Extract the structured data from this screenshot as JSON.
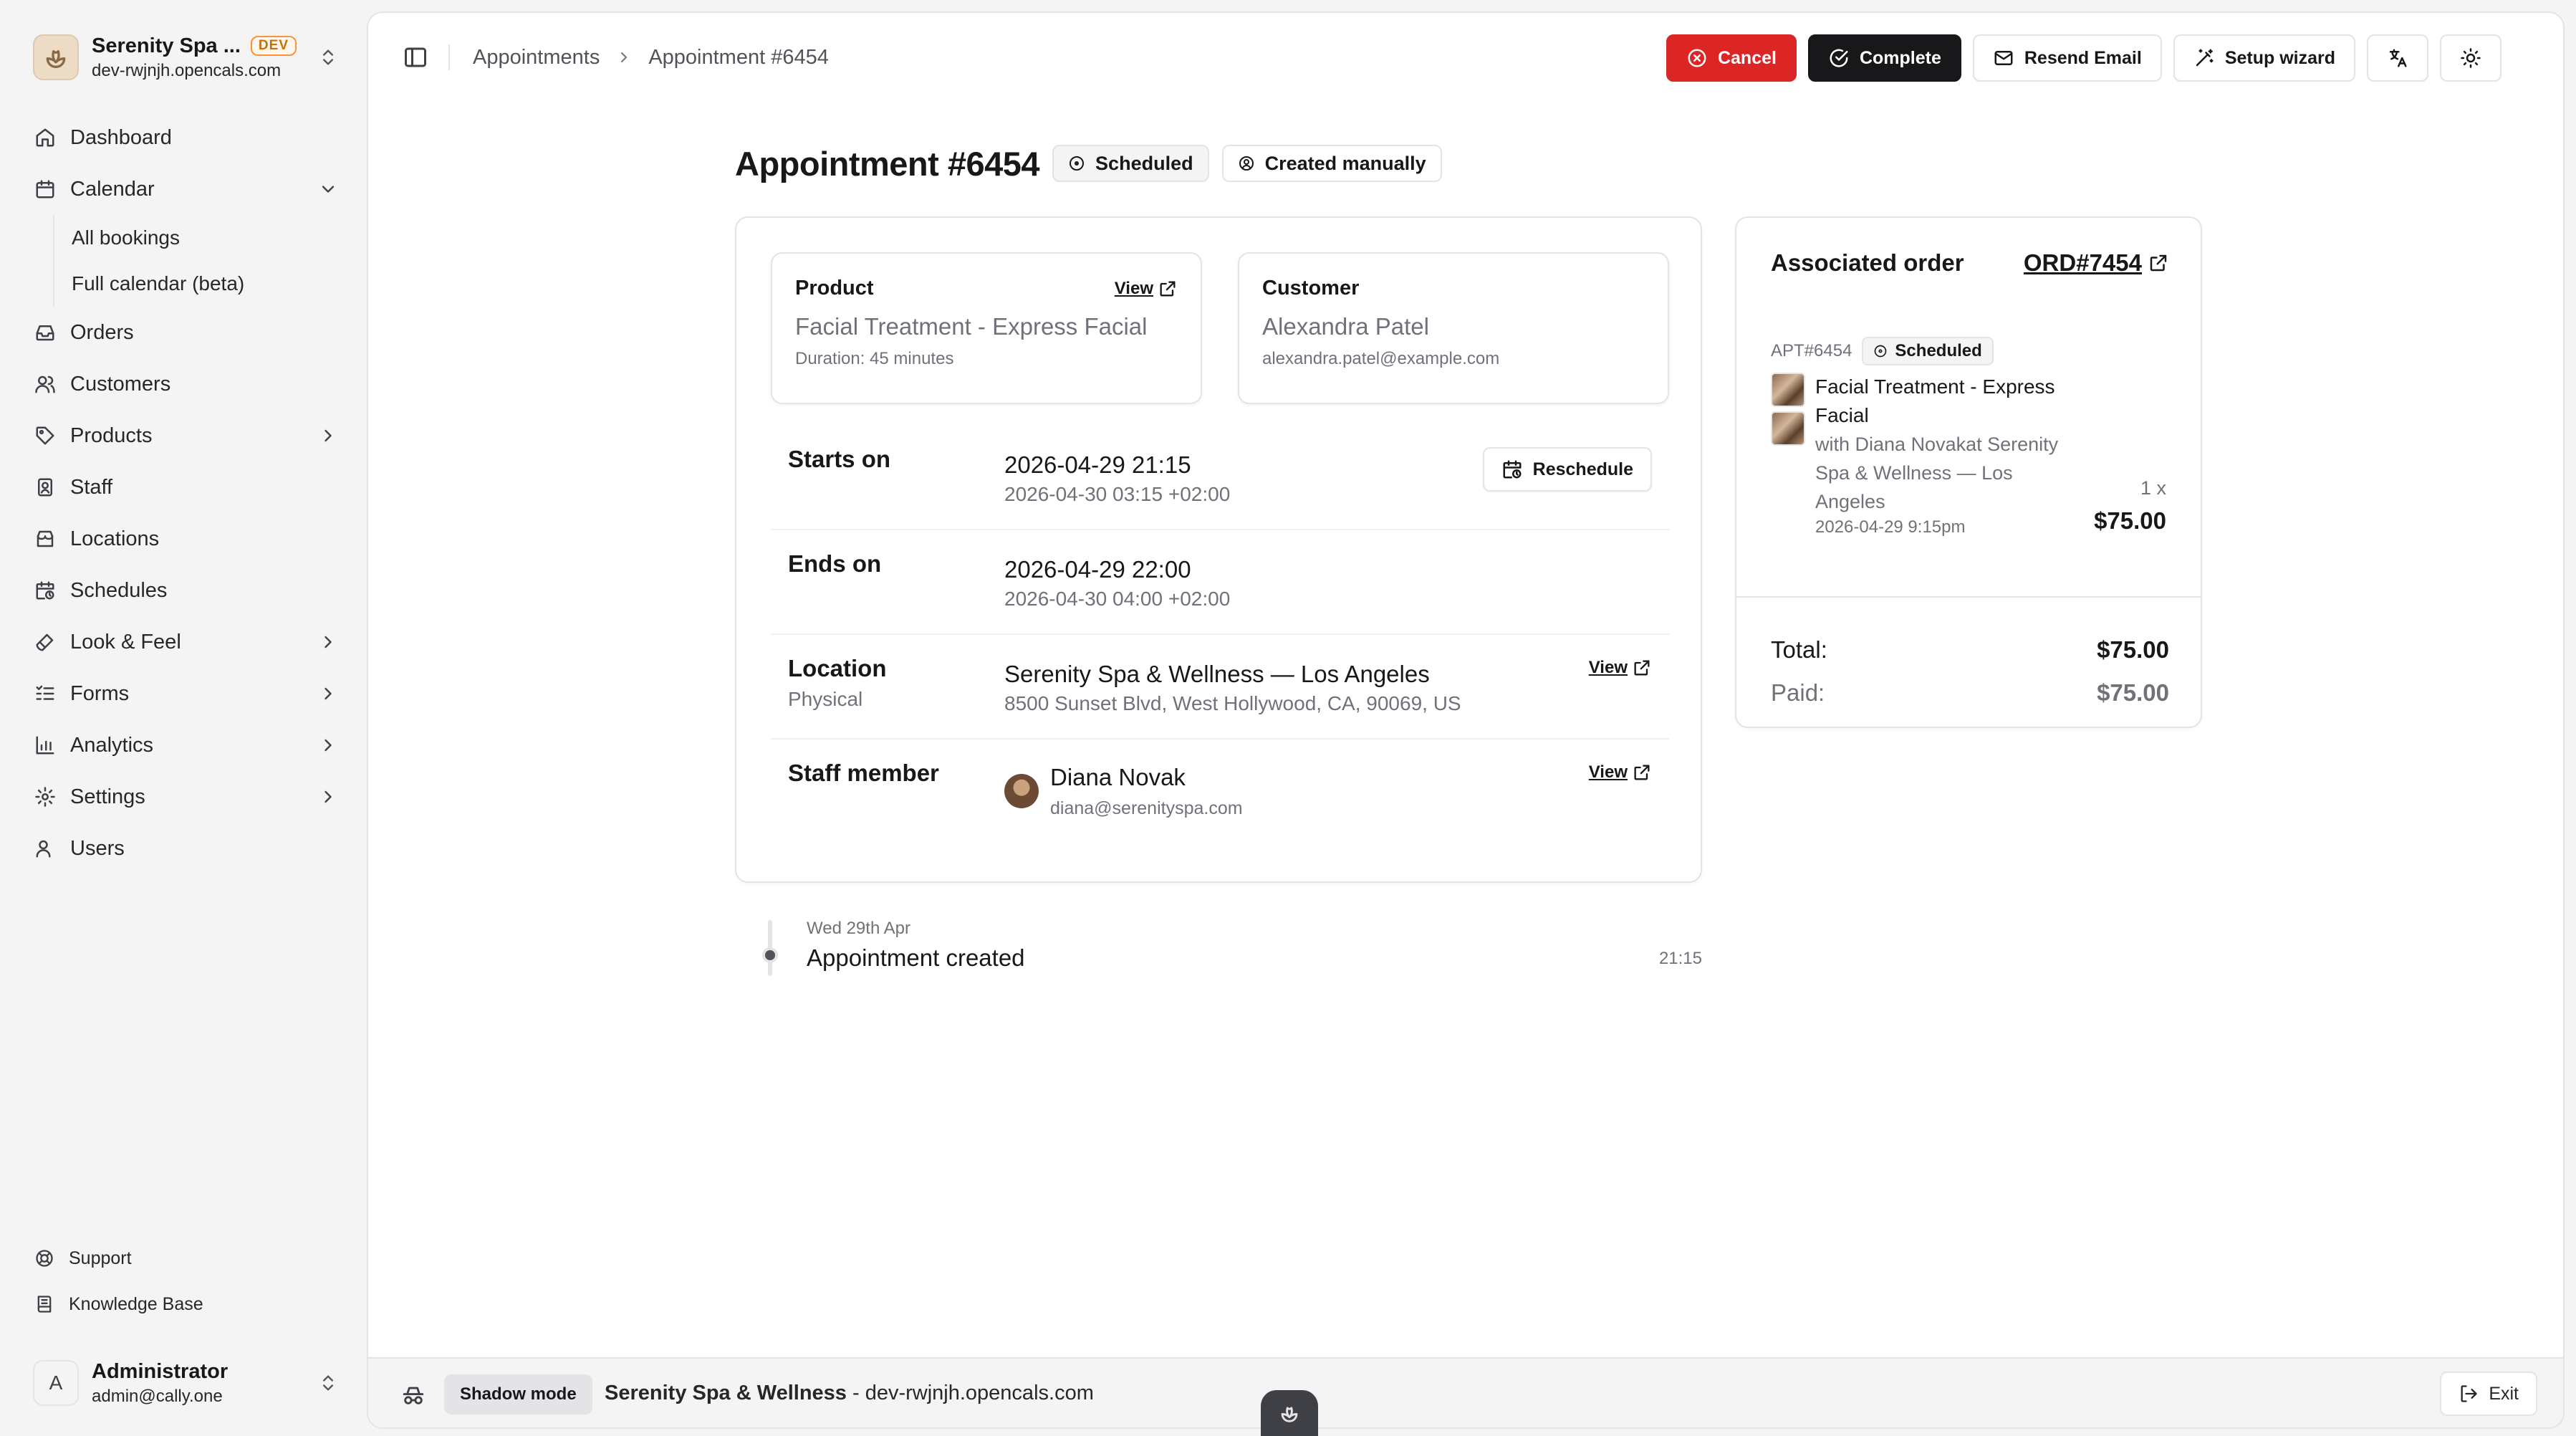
{
  "org": {
    "name": "Serenity Spa ...",
    "badge": "DEV",
    "domain": "dev-rwjnjh.opencals.com"
  },
  "nav": {
    "dashboard": "Dashboard",
    "calendar": "Calendar",
    "calendar_sub": [
      "All bookings",
      "Full calendar (beta)"
    ],
    "orders": "Orders",
    "customers": "Customers",
    "products": "Products",
    "staff": "Staff",
    "locations": "Locations",
    "schedules": "Schedules",
    "look_feel": "Look & Feel",
    "forms": "Forms",
    "analytics": "Analytics",
    "settings": "Settings",
    "users": "Users"
  },
  "support": {
    "support": "Support",
    "knowledge_base": "Knowledge Base"
  },
  "user": {
    "initial": "A",
    "name": "Administrator",
    "email": "admin@cally.one"
  },
  "breadcrumb": {
    "parent": "Appointments",
    "current": "Appointment #6454"
  },
  "toolbar": {
    "cancel": "Cancel",
    "complete": "Complete",
    "resend": "Resend Email",
    "setup": "Setup wizard"
  },
  "appointment": {
    "title": "Appointment #6454",
    "status": "Scheduled",
    "source": "Created manually",
    "product": {
      "heading": "Product",
      "view": "View",
      "name": "Facial Treatment - Express Facial",
      "duration": "Duration: 45 minutes"
    },
    "customer": {
      "heading": "Customer",
      "name": "Alexandra Patel",
      "email": "alexandra.patel@example.com"
    },
    "starts": {
      "label": "Starts on",
      "value": "2026-04-29 21:15",
      "alt": "2026-04-30 03:15 +02:00",
      "action": "Reschedule"
    },
    "ends": {
      "label": "Ends on",
      "value": "2026-04-29 22:00",
      "alt": "2026-04-30 04:00 +02:00"
    },
    "location": {
      "label": "Location",
      "type": "Physical",
      "name": "Serenity Spa & Wellness — Los Angeles",
      "address": "8500 Sunset Blvd, West Hollywood, CA, 90069, US",
      "view": "View"
    },
    "staff": {
      "label": "Staff member",
      "name": "Diana Novak",
      "email": "diana@serenityspa.com",
      "view": "View"
    }
  },
  "timeline": {
    "date": "Wed 29th Apr",
    "event": "Appointment created",
    "time": "21:15"
  },
  "order": {
    "heading": "Associated order",
    "id": "ORD#7454",
    "apt_id": "APT#6454",
    "apt_status": "Scheduled",
    "item_name_1": "Facial Treatment - Express",
    "item_name_2": "Facial",
    "item_with_1": "with Diana Novakat Serenity",
    "item_with_2": "Spa & Wellness — Los",
    "item_with_3": "Angeles",
    "item_date": "2026-04-29 9:15pm",
    "qty": "1 x",
    "price": "$75.00",
    "total_label": "Total:",
    "total": "$75.00",
    "paid_label": "Paid:",
    "paid": "$75.00"
  },
  "shadow": {
    "label": "Shadow mode",
    "org": "Serenity Spa & Wellness",
    "domain": " - dev-rwjnjh.opencals.com",
    "exit": "Exit"
  },
  "colors": {
    "danger": "#dc2626",
    "primary": "#18181b",
    "dev_badge": "#fb923c"
  }
}
